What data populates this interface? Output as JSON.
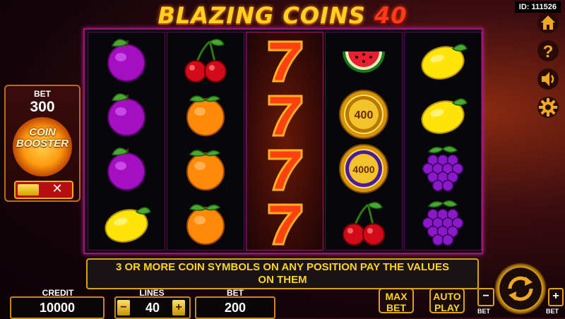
{
  "game": {
    "title_main": "BLAZING COINS",
    "title_number": "40",
    "id_label": "ID: 111526"
  },
  "reels": [
    [
      "plum",
      "plum",
      "plum",
      "lemon"
    ],
    [
      "cherry",
      "orange",
      "orange",
      "orange"
    ],
    [
      "seven",
      "seven",
      "seven",
      "seven"
    ],
    [
      "watermelon",
      "coin-400",
      "coin-4000",
      "cherry"
    ],
    [
      "lemon",
      "lemon",
      "grapes",
      "grapes"
    ]
  ],
  "coin_values": {
    "coin-400": "400",
    "coin-4000": "4000"
  },
  "bet_panel": {
    "label": "BET",
    "value": "300",
    "booster_line1": "COIN",
    "booster_line2": "BOOSTER",
    "toggle_off_symbol": "✕"
  },
  "side_menu": [
    "home-icon",
    "help-icon",
    "sound-icon",
    "settings-icon"
  ],
  "info_text_line1": "3 OR MORE COIN SYMBOLS ON ANY POSITION PAY THE VALUES",
  "info_text_line2": "ON THEM",
  "bottom": {
    "credit_label": "CREDIT",
    "credit_value": "10000",
    "lines_label": "LINES",
    "lines_value": "40",
    "lines_minus": "−",
    "lines_plus": "+",
    "bet_label": "BET",
    "bet_value": "200",
    "max_bet_line1": "MAX",
    "max_bet_line2": "BET",
    "auto_play_line1": "AUTO",
    "auto_play_line2": "PLAY",
    "bet_minus": "−",
    "bet_plus": "+",
    "bet_minus_label": "BET",
    "bet_plus_label": "BET"
  },
  "colors": {
    "accent_gold": "#e0a215",
    "frame_magenta": "#a0157a",
    "title_yellow": "#ffd21f",
    "title_red": "#ff3a1a"
  }
}
